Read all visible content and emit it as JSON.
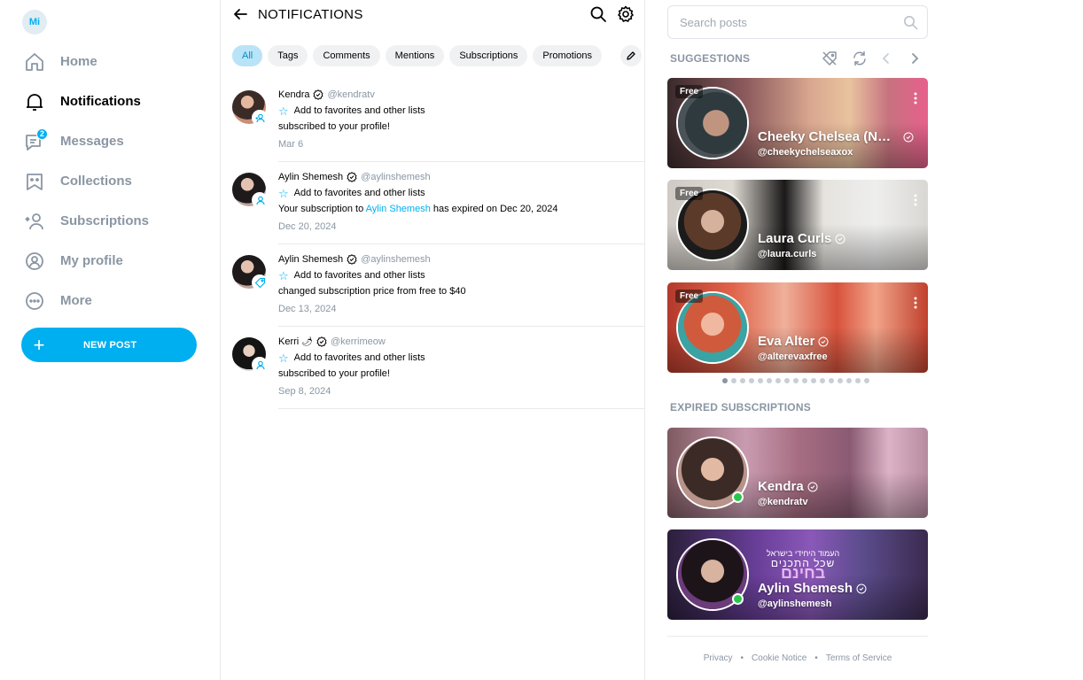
{
  "user": {
    "initials": "Mi"
  },
  "nav": [
    {
      "key": "home",
      "label": "Home",
      "icon": "home-icon",
      "active": false
    },
    {
      "key": "notifications",
      "label": "Notifications",
      "icon": "bell-icon",
      "active": true
    },
    {
      "key": "messages",
      "label": "Messages",
      "icon": "chat-icon",
      "badge": "2",
      "active": false
    },
    {
      "key": "collections",
      "label": "Collections",
      "icon": "bookmark-icon",
      "active": false
    },
    {
      "key": "subscriptions",
      "label": "Subscriptions",
      "icon": "subscriptions-icon",
      "active": false
    },
    {
      "key": "profile",
      "label": "My profile",
      "icon": "profile-icon",
      "active": false
    },
    {
      "key": "more",
      "label": "More",
      "icon": "more-icon",
      "active": false
    }
  ],
  "new_post": {
    "label": "NEW POST",
    "icon": "+"
  },
  "header": {
    "title": "NOTIFICATIONS"
  },
  "filters": [
    "All",
    "Tags",
    "Comments",
    "Mentions",
    "Subscriptions",
    "Promotions"
  ],
  "active_filter": "All",
  "notifications": [
    {
      "name": "Kendra",
      "handle": "@kendratv",
      "favorites": "Add to favorites and other lists",
      "text": "subscribed to your profile!",
      "date": "Mar 6",
      "type": "subscribe-icon"
    },
    {
      "name": "Aylin Shemesh",
      "handle": "@aylinshemesh",
      "favorites": "Add to favorites and other lists",
      "text_prefix": "Your subscription to ",
      "text_link": "Aylin Shemesh",
      "text_suffix": " has expired on Dec 20, 2024",
      "date": "Dec 20, 2024",
      "type": "subscribe-icon"
    },
    {
      "name": "Aylin Shemesh",
      "handle": "@aylinshemesh",
      "favorites": "Add to favorites and other lists",
      "text": "changed subscription price from free to $40",
      "date": "Dec 13, 2024",
      "type": "price-tag-icon"
    },
    {
      "name": "Kerri",
      "name_suffix": "🌶",
      "handle": "@kerrimeow",
      "favorites": "Add to favorites and other lists",
      "text": "subscribed to your profile!",
      "date": "Sep 8, 2024",
      "type": "subscribe-icon"
    }
  ],
  "search": {
    "placeholder": "Search posts"
  },
  "suggestions": {
    "title": "SUGGESTIONS",
    "cards": [
      {
        "name": "Cheeky Chelsea (NSFW)",
        "handle": "@cheekychelseaxox",
        "badge": "Free"
      },
      {
        "name": "Laura Curls",
        "handle": "@laura.curls",
        "badge": "Free"
      },
      {
        "name": "Eva Alter",
        "handle": "@alterevaxfree",
        "badge": "Free"
      }
    ],
    "pages": 17,
    "current_page": 1
  },
  "expired": {
    "title": "EXPIRED SUBSCRIPTIONS",
    "cards": [
      {
        "name": "Kendra",
        "handle": "@kendratv",
        "online": true
      },
      {
        "name": "Aylin Shemesh",
        "handle": "@aylinshemesh",
        "online": true,
        "banner_text": [
          "העמוד היחידי בישראל",
          "שכל התכנים",
          "בחינם"
        ]
      }
    ]
  },
  "footer": {
    "links": [
      "Privacy",
      "Cookie Notice",
      "Terms of Service"
    ]
  },
  "colors": {
    "accent": "#00aff0",
    "muted": "#8a96a3",
    "online": "#2ac54a",
    "chip_active_bg": "#b9e3f7"
  }
}
